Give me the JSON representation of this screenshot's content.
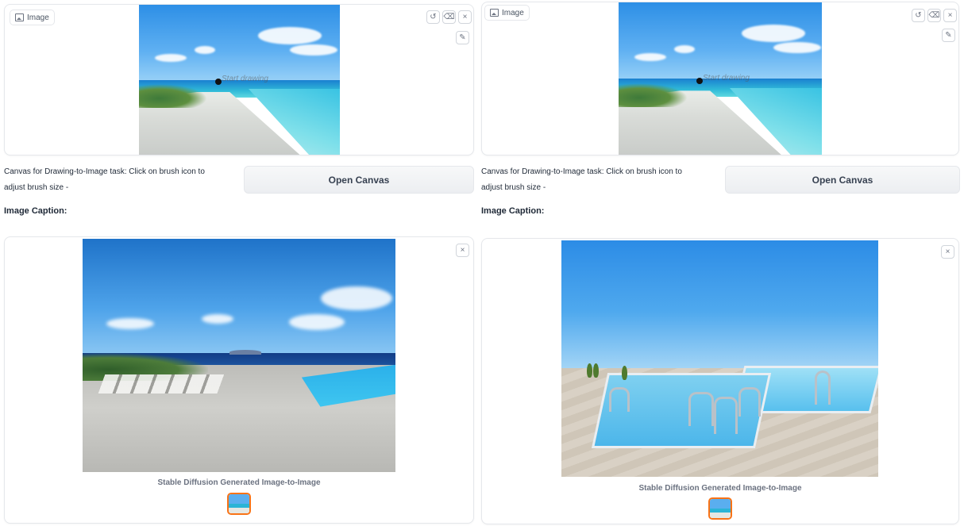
{
  "panels": [
    {
      "input_image": {
        "label": "Image",
        "overlay_text": "Start drawing",
        "tool_icons": [
          "undo-icon",
          "erase-icon",
          "close-icon"
        ],
        "brush_icon": "brush-icon"
      },
      "description": "Canvas for Drawing-to-Image task: Click on brush icon to adjust brush size -",
      "open_canvas_label": "Open Canvas",
      "caption_label": "Image Caption:",
      "output": {
        "caption": "Stable Diffusion Generated Image-to-Image",
        "close_icon": "close-icon"
      }
    },
    {
      "input_image": {
        "label": "Image",
        "overlay_text": "Start drawing",
        "tool_icons": [
          "undo-icon",
          "erase-icon",
          "close-icon"
        ],
        "brush_icon": "brush-icon"
      },
      "description": "Canvas for Drawing-to-Image task: Click on brush icon to adjust brush size -",
      "open_canvas_label": "Open Canvas",
      "caption_label": "Image Caption:",
      "output": {
        "caption": "Stable Diffusion Generated Image-to-Image",
        "close_icon": "close-icon"
      }
    }
  ],
  "colors": {
    "accent": "#f97316",
    "border": "#e5e7eb",
    "button_bg": "#eceef1"
  }
}
